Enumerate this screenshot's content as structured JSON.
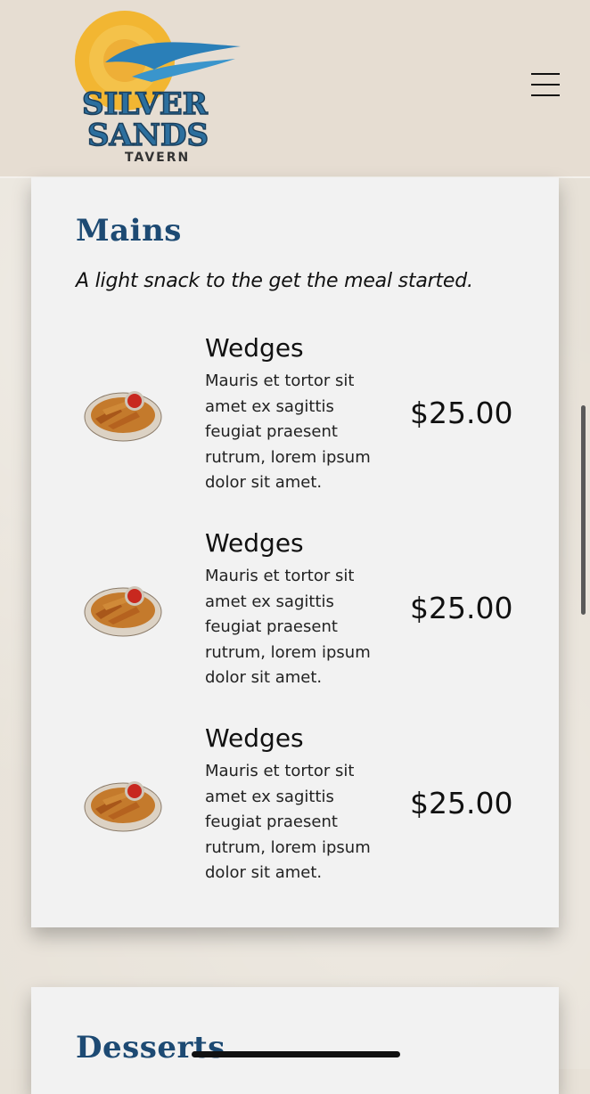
{
  "brand": {
    "logo_line1": "SILVER",
    "logo_line2": "SANDS",
    "logo_line3": "TAVERN",
    "colors": {
      "sun": "#f2b632",
      "wave": "#2a7fb8",
      "text": "#2c6f9e"
    }
  },
  "header": {
    "menu_icon": "hamburger-menu-icon"
  },
  "sections": [
    {
      "title": "Mains",
      "subtitle": "A light snack to the get the meal started.",
      "items": [
        {
          "name": "Wedges",
          "description": "Mauris et tortor sit amet ex sagittis feugiat praesent rutrum, lorem ipsum dolor sit amet.",
          "price": "$25.00"
        },
        {
          "name": "Wedges",
          "description": "Mauris et tortor sit amet ex sagittis feugiat praesent rutrum, lorem ipsum dolor sit amet.",
          "price": "$25.00"
        },
        {
          "name": "Wedges",
          "description": "Mauris et tortor sit amet ex sagittis feugiat praesent rutrum, lorem ipsum dolor sit amet.",
          "price": "$25.00"
        }
      ]
    },
    {
      "title": "Desserts"
    }
  ],
  "theme": {
    "title_color": "#1d4a73",
    "card_bg": "#f2f2f2",
    "page_bg": "#e7e1d7"
  }
}
